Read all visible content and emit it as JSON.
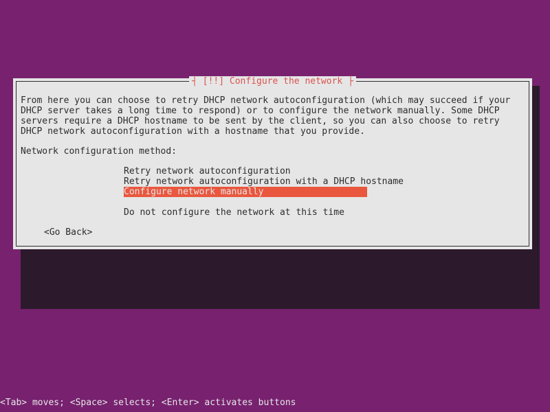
{
  "dialog": {
    "title": "┤ [!!] Configure the network ├",
    "description": "From here you can choose to retry DHCP network autoconfiguration (which may succeed if your DHCP server takes a long time to respond) or to configure the network manually. Some DHCP servers require a DHCP hostname to be sent by the client, so you can also choose to retry DHCP network autoconfiguration with a hostname that you provide.",
    "prompt": "Network configuration method:",
    "options": [
      {
        "label": "Retry network autoconfiguration",
        "selected": false
      },
      {
        "label": "Retry network autoconfiguration with a DHCP hostname",
        "selected": false
      },
      {
        "label": "Configure network manually",
        "selected": true
      },
      {
        "label": "",
        "selected": false
      },
      {
        "label": "Do not configure the network at this time",
        "selected": false
      }
    ],
    "go_back": "<Go Back>"
  },
  "footer": "<Tab> moves; <Space> selects; <Enter> activates buttons"
}
